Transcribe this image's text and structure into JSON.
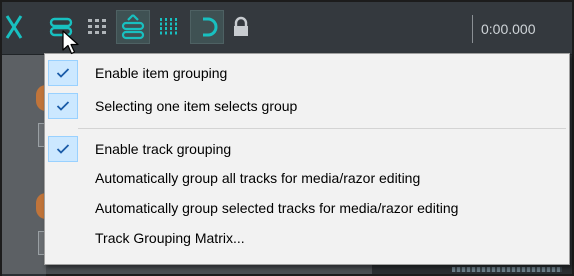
{
  "toolbar": {
    "buttons": [
      {
        "icon": "crossfade-icon"
      },
      {
        "icon": "item-grouping-link-icon"
      },
      {
        "icon": "snap-grid-icon"
      },
      {
        "icon": "track-grouping-icon"
      },
      {
        "icon": "grid-lines-icon"
      },
      {
        "icon": "loop-repeat-icon"
      },
      {
        "icon": "lock-icon"
      }
    ],
    "time": "0:00.000"
  },
  "menu": {
    "items": [
      {
        "label": "Enable item grouping",
        "checked": true
      },
      {
        "label": "Selecting one item selects group",
        "checked": true
      },
      {
        "label": "Enable track grouping",
        "checked": true
      },
      {
        "label": "Automatically group all tracks for media/razor editing",
        "checked": false
      },
      {
        "label": "Automatically group selected tracks for media/razor editing",
        "checked": false
      },
      {
        "label": "Track Grouping Matrix...",
        "checked": false
      }
    ]
  },
  "colors": {
    "toolbar_bg": "#34393e",
    "icon_teal": "#18c0c0",
    "menu_bg": "#f2f2f2",
    "check_highlight": "#cce8ff",
    "check_mark": "#1a5ba8"
  }
}
